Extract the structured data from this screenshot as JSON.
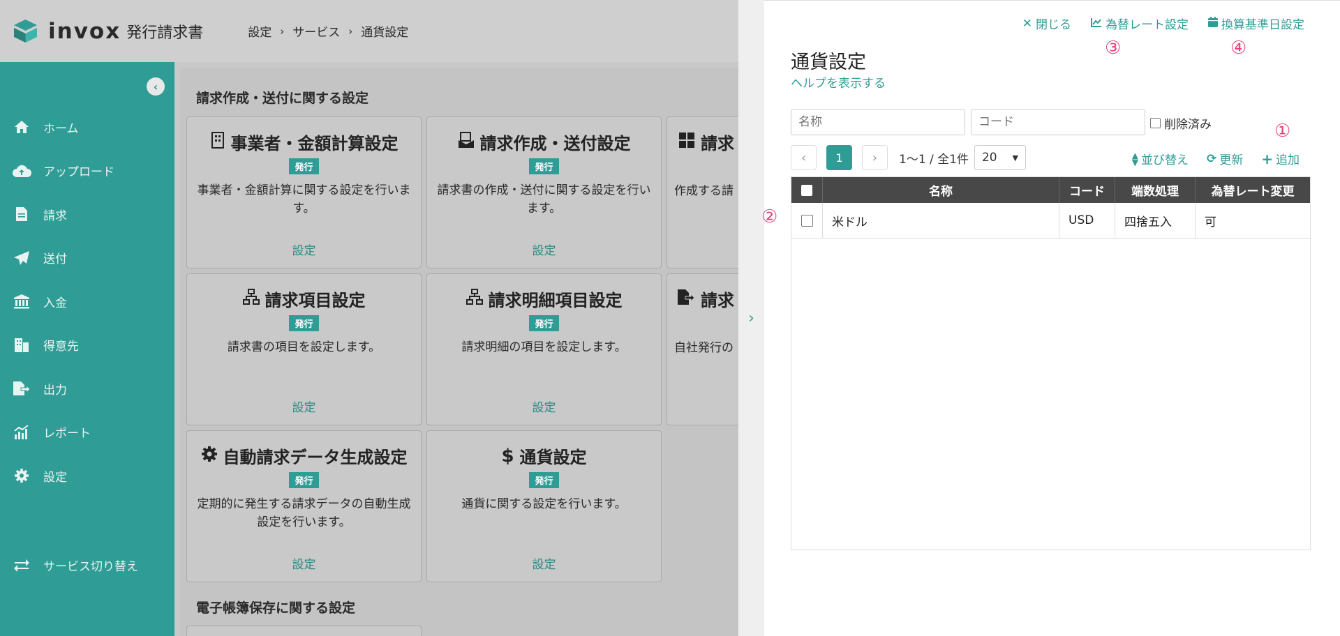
{
  "app": {
    "logo_name": "invox",
    "logo_sub": "発行請求書",
    "breadcrumb": [
      "設定",
      "サービス",
      "通貨設定"
    ]
  },
  "sidebar": {
    "items": [
      {
        "label": "ホーム",
        "icon": "home-icon"
      },
      {
        "label": "アップロード",
        "icon": "cloud-upload-icon"
      },
      {
        "label": "請求",
        "icon": "document-icon"
      },
      {
        "label": "送付",
        "icon": "paper-plane-icon"
      },
      {
        "label": "入金",
        "icon": "bank-icon"
      },
      {
        "label": "得意先",
        "icon": "building-icon"
      },
      {
        "label": "出力",
        "icon": "file-export-icon"
      },
      {
        "label": "レポート",
        "icon": "chart-icon"
      },
      {
        "label": "設定",
        "icon": "gear-icon"
      }
    ],
    "switch_label": "サービス切り替え"
  },
  "content": {
    "section1_title": "請求作成・送付に関する設定",
    "section2_title": "電子帳簿保存に関する設定",
    "cards": [
      {
        "title": "事業者・金額計算設定",
        "icon": "building-icon",
        "badge": "発行",
        "desc": "事業者・金額計算に関する設定を行います。",
        "link": "設定"
      },
      {
        "title": "請求作成・送付設定",
        "icon": "invoice-send-icon",
        "badge": "発行",
        "desc": "請求書の作成・送付に関する設定を行います。",
        "link": "設定"
      },
      {
        "title": "請求",
        "icon": "grid-icon",
        "badge": "",
        "desc": "作成する請",
        "link": ""
      },
      {
        "title": "請求項目設定",
        "icon": "sitemap-icon",
        "badge": "発行",
        "desc": "請求書の項目を設定します。",
        "link": "設定"
      },
      {
        "title": "請求明細項目設定",
        "icon": "sitemap-icon",
        "badge": "発行",
        "desc": "請求明細の項目を設定します。",
        "link": "設定"
      },
      {
        "title": "請求",
        "icon": "file-export-icon",
        "badge": "",
        "desc": "自社発行の",
        "link": ""
      },
      {
        "title": "自動請求データ生成設定",
        "icon": "gear-icon",
        "badge": "発行",
        "desc": "定期的に発生する請求データの自動生成設定を行います。",
        "link": "設定"
      },
      {
        "title": "通貨設定",
        "icon": "dollar-icon",
        "badge": "発行",
        "desc": "通貨に関する設定を行います。",
        "link": "設定"
      }
    ]
  },
  "panel": {
    "actions": {
      "close": "閉じる",
      "fx_rate": "為替レート設定",
      "base_date": "換算基準日設定"
    },
    "markers": [
      "①",
      "②",
      "③",
      "④"
    ],
    "title": "通貨設定",
    "help": "ヘルプを表示する",
    "filters": {
      "name_placeholder": "名称",
      "code_placeholder": "コード",
      "deleted_label": "削除済み"
    },
    "pager": {
      "current": "1",
      "info": "1〜1 / 全1件",
      "page_size": "20"
    },
    "tools": {
      "sort": "並び替え",
      "refresh": "更新",
      "add": "追加"
    },
    "table": {
      "headers": [
        "名称",
        "コード",
        "端数処理",
        "為替レート変更"
      ],
      "rows": [
        {
          "name": "米ドル",
          "code": "USD",
          "rounding": "四捨五入",
          "fx_change": "可"
        }
      ]
    }
  },
  "colors": {
    "accent": "#2f9c95",
    "marker": "#e0457b",
    "header_bg": "#484848"
  }
}
